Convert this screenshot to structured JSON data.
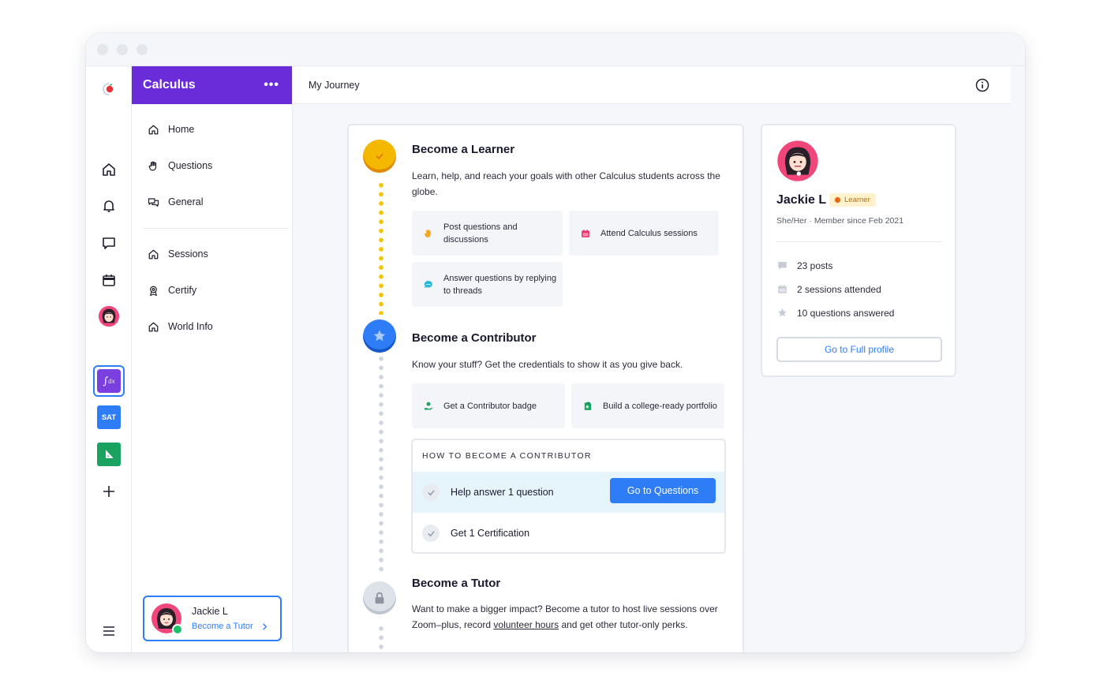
{
  "app": {
    "class_name": "Calculus",
    "more_label": "•••",
    "page_title": "My Journey",
    "accent": "#6a2bd8",
    "primary": "#2e7cf6"
  },
  "rail": {
    "items": [
      {
        "name": "home-icon"
      },
      {
        "name": "bell-icon"
      },
      {
        "name": "chat-icon"
      },
      {
        "name": "calendar-icon"
      },
      {
        "name": "avatar"
      },
      {
        "name": "calculus-class-icon",
        "label": "dx"
      },
      {
        "name": "sat-class-icon",
        "label": "SAT"
      },
      {
        "name": "geometry-class-icon"
      },
      {
        "name": "plus-icon"
      },
      {
        "name": "menu-icon"
      }
    ]
  },
  "sidebar": {
    "items": [
      {
        "label": "Home",
        "icon": "home-icon"
      },
      {
        "label": "Questions",
        "icon": "hand-icon"
      },
      {
        "label": "General",
        "icon": "chat-bubbles-icon"
      },
      {
        "label": "Sessions",
        "icon": "home-icon"
      },
      {
        "label": "Certify",
        "icon": "award-icon"
      },
      {
        "label": "World Info",
        "icon": "home-icon"
      }
    ],
    "user": {
      "name": "Jackie L",
      "link": "Become a Tutor"
    }
  },
  "journey": {
    "learner": {
      "title": "Become a Learner",
      "desc": "Learn, help, and reach your goals with other Calculus students across the globe.",
      "tiles": [
        {
          "label": "Post questions and discussions",
          "icon": "hand-wave-icon",
          "color": "#f5a623"
        },
        {
          "label": "Attend Calculus sessions",
          "icon": "calendar-icon",
          "color": "#e8336d"
        },
        {
          "label": "Answer questions by replying to threads",
          "icon": "speech-bubble-icon",
          "color": "#22b8d6"
        }
      ]
    },
    "contributor": {
      "title": "Become a Contributor",
      "desc": "Know your stuff? Get the credentials to show it as you give back.",
      "tiles": [
        {
          "label": "Get a Contributor badge",
          "icon": "badge-hand-icon",
          "color": "#1aa261"
        },
        {
          "label": "Build a college-ready portfolio",
          "icon": "portfolio-icon",
          "color": "#1aa261"
        }
      ],
      "howto": {
        "heading": "HOW TO BECOME A CONTRIBUTOR",
        "tasks": [
          {
            "label": "Help answer 1 question",
            "button": "Go to Questions"
          },
          {
            "label": "Get 1 Certification"
          }
        ]
      }
    },
    "tutor": {
      "title": "Become a Tutor",
      "desc_before": "Want to make a bigger impact? Become a tutor to host live sessions over Zoom–plus, record ",
      "desc_link": "volunteer hours",
      "desc_after": " and get other tutor-only perks."
    }
  },
  "profile": {
    "name": "Jackie L",
    "badge": "Learner",
    "meta": "She/Her · Member since Feb 2021",
    "stats": [
      {
        "label": "23 posts",
        "icon": "comment-icon"
      },
      {
        "label": "2 sessions attended",
        "icon": "calendar-icon"
      },
      {
        "label": "10 questions answered",
        "icon": "star-icon"
      }
    ],
    "button": "Go to Full profile"
  }
}
